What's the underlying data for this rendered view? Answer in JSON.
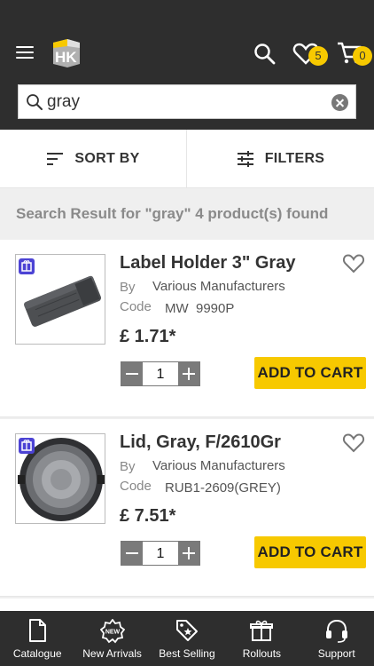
{
  "header": {
    "logo_text": "HK",
    "wishlist_count": "5",
    "cart_count": "0"
  },
  "search": {
    "value": "gray",
    "placeholder": ""
  },
  "sortbar": {
    "sort_label": "SORT BY",
    "filter_label": "FILTERS"
  },
  "results": {
    "summary": "Search Result for \"gray\" 4 product(s) found"
  },
  "products": [
    {
      "name": "Label Holder 3\" Gray",
      "by_label": "By",
      "manufacturer": "Various Manufacturers",
      "code_label": "Code",
      "code": "MW  9990P",
      "price": "£ 1.71*",
      "quantity": "1",
      "add_label": "ADD TO CART"
    },
    {
      "name": "Lid, Gray, F/2610Gr",
      "by_label": "By",
      "manufacturer": "Various Manufacturers",
      "code_label": "Code",
      "code": "RUB1-2609(GREY)",
      "price": "£ 7.51*",
      "quantity": "1",
      "add_label": "ADD TO CART"
    }
  ],
  "bottom_nav": {
    "items": [
      {
        "label": "Catalogue",
        "icon": "document-icon"
      },
      {
        "label": "New Arrivals",
        "icon": "new-badge-icon"
      },
      {
        "label": "Best Selling",
        "icon": "tag-star-icon"
      },
      {
        "label": "Rollouts",
        "icon": "gift-box-icon"
      },
      {
        "label": "Support",
        "icon": "headset-icon"
      }
    ]
  },
  "colors": {
    "header_bg": "#2e2e2e",
    "accent": "#f7c900",
    "tag_purple": "#4c43d4"
  }
}
